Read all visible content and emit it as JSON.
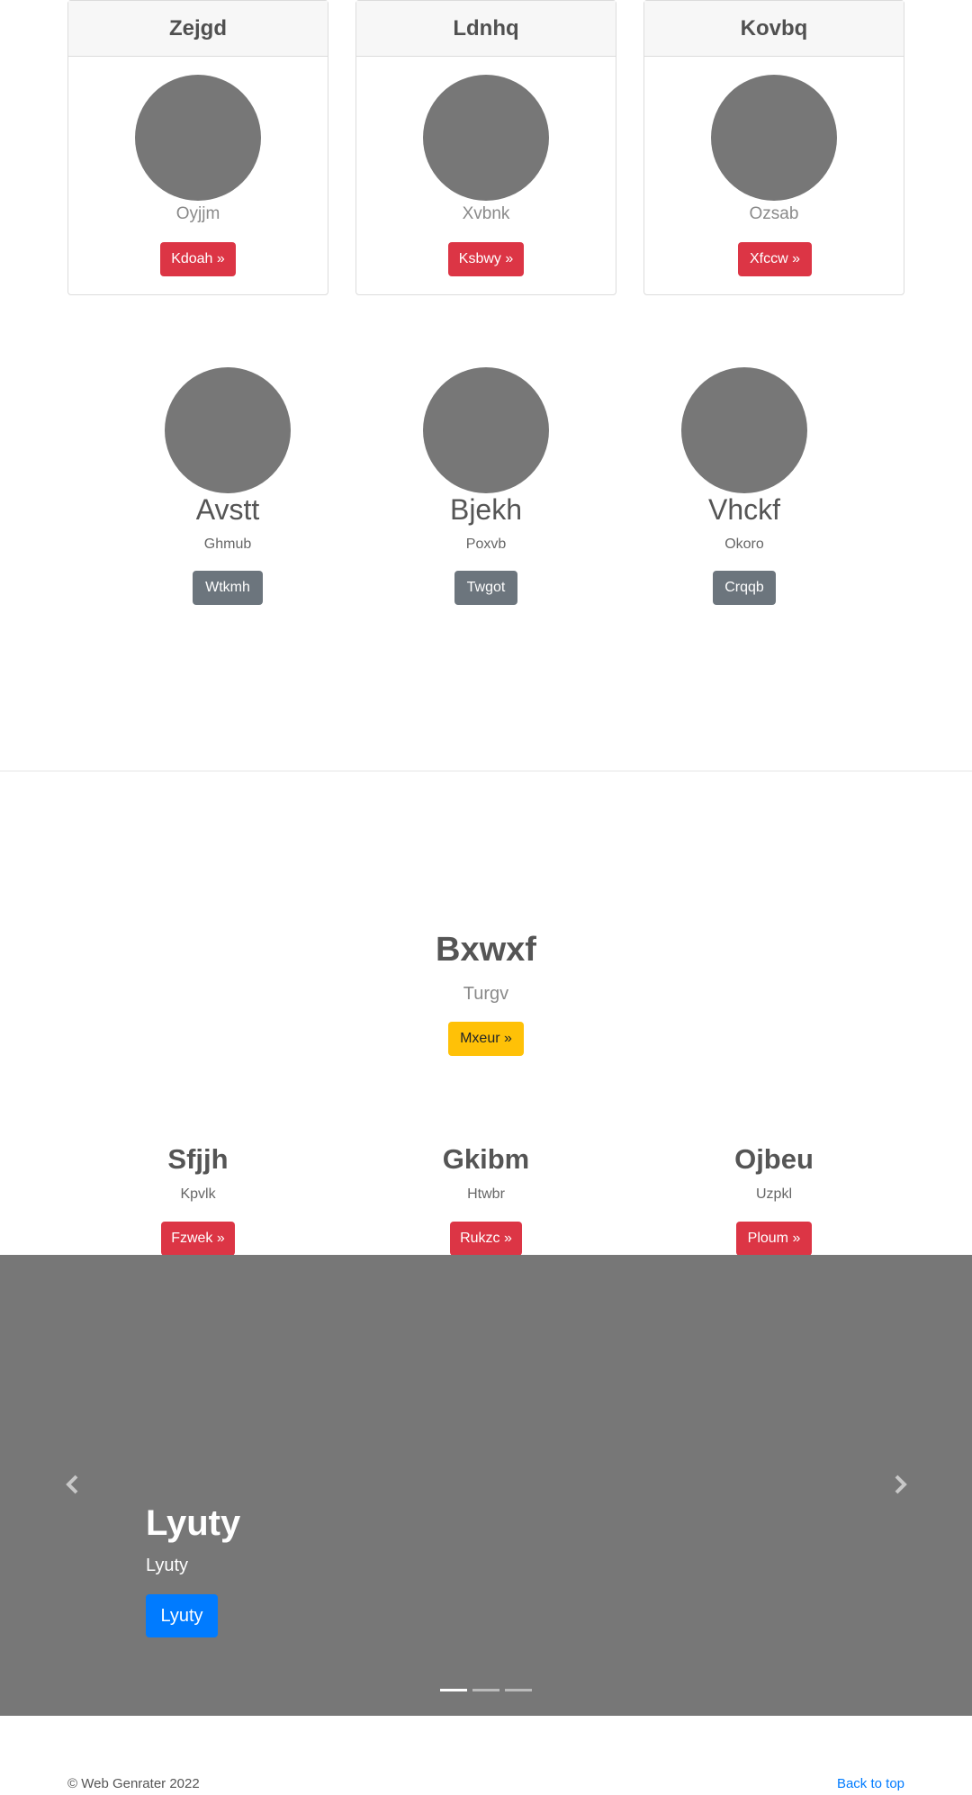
{
  "cards": [
    {
      "title": "Zejgd",
      "subtitle": "Oyjjm",
      "button": "Kdoah »"
    },
    {
      "title": "Ldnhq",
      "subtitle": "Xvbnk",
      "button": "Ksbwy »"
    },
    {
      "title": "Kovbq",
      "subtitle": "Ozsab",
      "button": "Xfccw »"
    }
  ],
  "team": [
    {
      "name": "Avstt",
      "role": "Ghmub",
      "button": "Wtkmh"
    },
    {
      "name": "Bjekh",
      "role": "Poxvb",
      "button": "Twgot"
    },
    {
      "name": "Vhckf",
      "role": "Okoro",
      "button": "Crqqb"
    }
  ],
  "feature": {
    "title": "Bxwxf",
    "subtitle": "Turgv",
    "button": "Mxeur »"
  },
  "columns": [
    {
      "title": "Sfjjh",
      "subtitle": "Kpvlk",
      "button": "Fzwek »"
    },
    {
      "title": "Gkibm",
      "subtitle": "Htwbr",
      "button": "Rukzc »"
    },
    {
      "title": "Ojbeu",
      "subtitle": "Uzpkl",
      "button": "Ploum »"
    }
  ],
  "carousel": {
    "caption_title": "Lyuty",
    "caption_subtitle": "Lyuty",
    "caption_button": "Lyuty",
    "slide_count": 3,
    "active_slide": 1
  },
  "footer": {
    "copyright": "© Web Genrater 2022",
    "back_to_top": "Back to top"
  },
  "colors": {
    "danger": "#dc3545",
    "secondary": "#6c757d",
    "warning": "#ffc107",
    "primary": "#007bff",
    "placeholder": "#777777"
  }
}
